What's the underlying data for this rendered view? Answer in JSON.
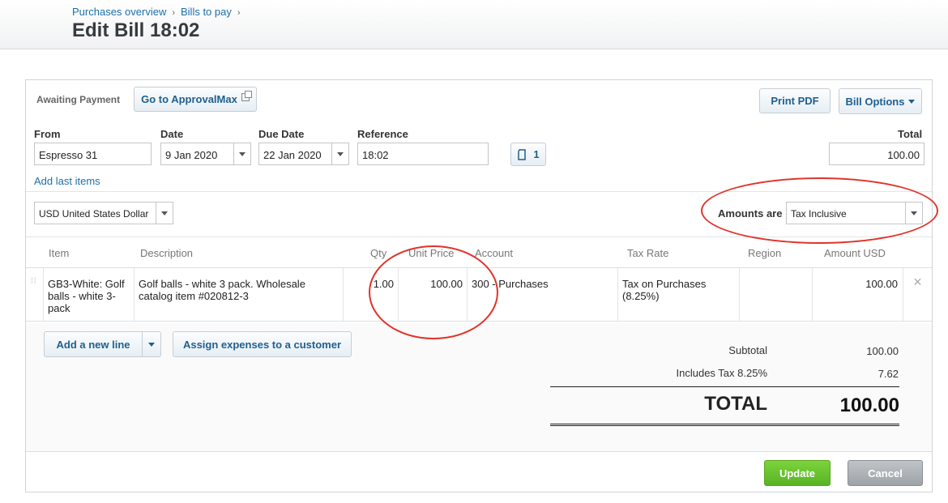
{
  "breadcrumb": {
    "items": [
      "Purchases overview",
      "Bills to pay"
    ],
    "separator": "›"
  },
  "page_title": "Edit Bill 18:02",
  "toolbar": {
    "status": "Awaiting Payment",
    "approval_label": "Go to ApprovalMax",
    "print_label": "Print PDF",
    "options_label": "Bill Options"
  },
  "form": {
    "from_label": "From",
    "from_value": "Espresso 31",
    "date_label": "Date",
    "date_value": "9 Jan 2020",
    "due_label": "Due Date",
    "due_value": "22 Jan 2020",
    "ref_label": "Reference",
    "ref_value": "18:02",
    "attachments_count": "1",
    "total_label": "Total",
    "total_value": "100.00",
    "add_last": "Add last items"
  },
  "currency": {
    "value": "USD United States Dollar",
    "amounts_label": "Amounts are",
    "amounts_value": "Tax Inclusive"
  },
  "columns": [
    "Item",
    "Description",
    "Qty",
    "Unit Price",
    "Account",
    "Tax Rate",
    "Region",
    "Amount USD"
  ],
  "line": {
    "item": "GB3-White: Golf balls - white 3-pack",
    "description": "Golf balls - white 3 pack. Wholesale catalog item #020812-3",
    "qty": "1.00",
    "unit_price": "100.00",
    "account": "300 - Purchases",
    "tax_rate": "Tax on Purchases (8.25%)",
    "region": "",
    "amount": "100.00",
    "remove": "×"
  },
  "actions": {
    "add_line": "Add a new line",
    "assign": "Assign expenses to a customer"
  },
  "totals": {
    "subtotal_label": "Subtotal",
    "subtotal": "100.00",
    "tax_label": "Includes Tax 8.25%",
    "tax": "7.62",
    "total_label": "TOTAL",
    "total": "100.00"
  },
  "footer": {
    "update": "Update",
    "cancel": "Cancel"
  },
  "colors": {
    "link": "#1d6fa9",
    "update": "#58b325",
    "annotation": "#e0342b"
  }
}
